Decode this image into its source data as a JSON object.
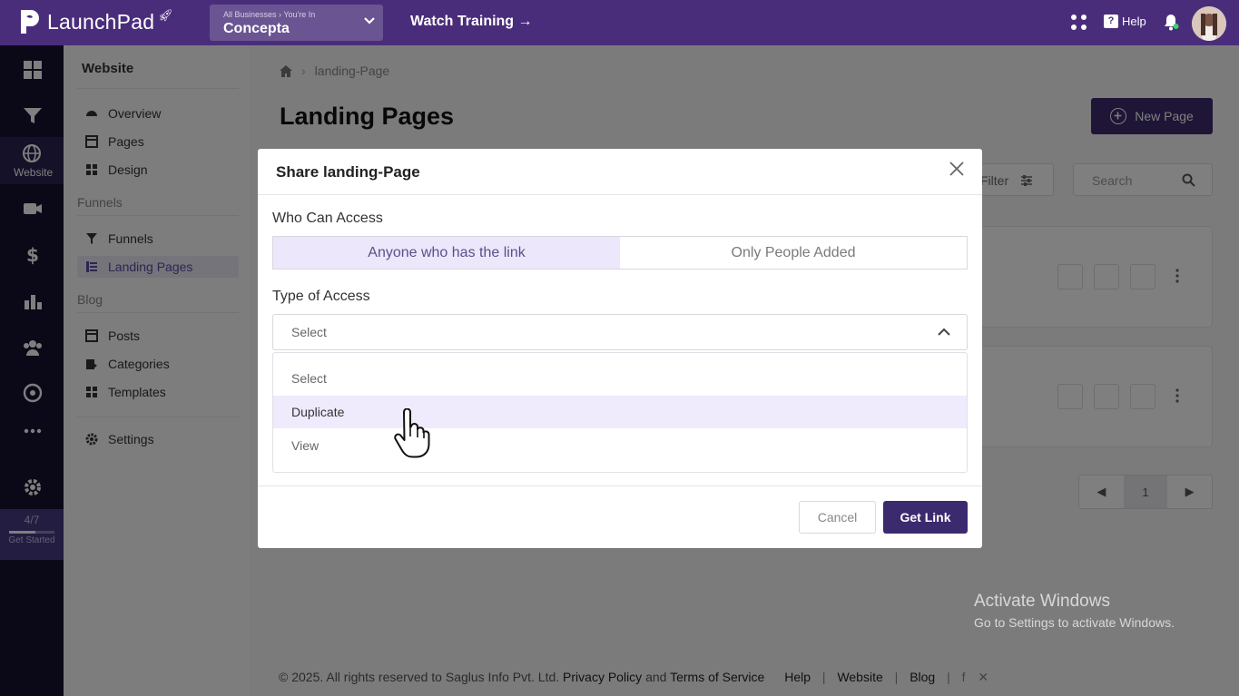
{
  "topbar": {
    "brand": "LaunchPad",
    "business_crumb": "All Businesses › You're In",
    "business_name": "Concepta",
    "watch_training": "Watch Training →",
    "help": "Help"
  },
  "rail": {
    "website_label": "Website",
    "progress": "4/7",
    "progress_fraction": 0.57,
    "get_started": "Get Started"
  },
  "side": {
    "title": "Website",
    "items_website": [
      {
        "label": "Overview",
        "icon": "dashboard-icon"
      },
      {
        "label": "Pages",
        "icon": "pages-icon"
      },
      {
        "label": "Design",
        "icon": "design-icon"
      }
    ],
    "section_funnels": "Funnels",
    "items_funnels": [
      {
        "label": "Funnels",
        "icon": "funnel-icon"
      },
      {
        "label": "Landing Pages",
        "icon": "list-icon"
      }
    ],
    "section_blog": "Blog",
    "items_blog": [
      {
        "label": "Posts",
        "icon": "posts-icon"
      },
      {
        "label": "Categories",
        "icon": "categories-icon"
      },
      {
        "label": "Templates",
        "icon": "templates-icon"
      }
    ],
    "settings": "Settings"
  },
  "main": {
    "breadcrumb": "landing-Page",
    "title": "Landing Pages",
    "new_page": "New Page",
    "filter": "Filter",
    "search_placeholder": "Search",
    "page_number": "1"
  },
  "footer": {
    "copyright": "© 2025. All rights reserved to Saglus Info Pvt. Ltd.",
    "privacy": "Privacy Policy",
    "and": "and",
    "terms": "Terms of Service",
    "help": "Help",
    "website": "Website",
    "blog": "Blog"
  },
  "modal": {
    "title": "Share landing-Page",
    "who_label": "Who Can Access",
    "access_options": [
      "Anyone who has the link",
      "Only People Added"
    ],
    "access_selected": "Anyone who has the link",
    "type_label": "Type of Access",
    "select_value": "Select",
    "dropdown_options": [
      "Select",
      "Duplicate",
      "View"
    ],
    "dropdown_highlighted": "Duplicate",
    "cancel": "Cancel",
    "get_link": "Get Link"
  },
  "watermark": {
    "line1": "Activate Windows",
    "line2": "Go to Settings to activate Windows."
  },
  "colors": {
    "brand": "#4a2d7a",
    "primary_button": "#3c2a6e",
    "selected_tint": "#ede7fb"
  }
}
